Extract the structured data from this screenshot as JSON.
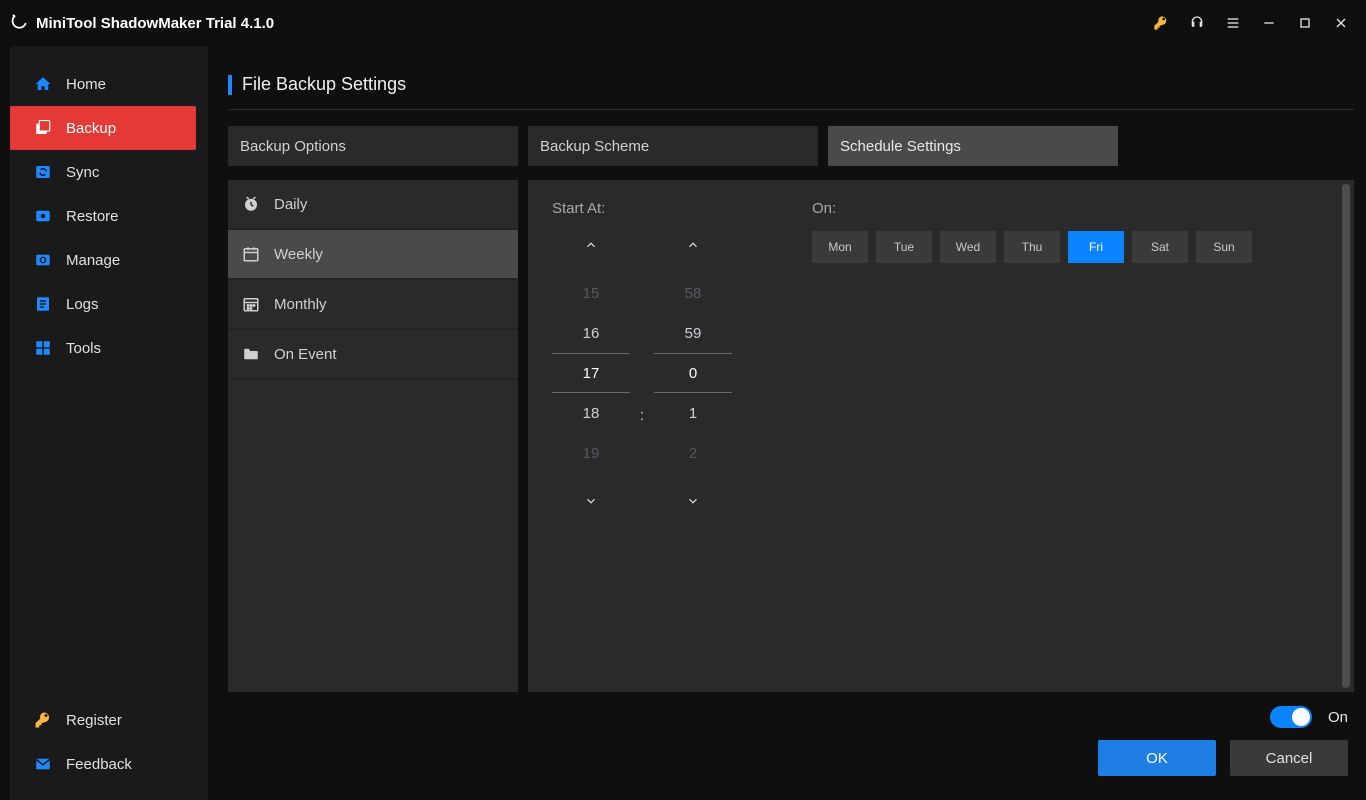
{
  "app": {
    "title": "MiniTool ShadowMaker Trial 4.1.0"
  },
  "sidebar": {
    "items": [
      {
        "label": "Home"
      },
      {
        "label": "Backup"
      },
      {
        "label": "Sync"
      },
      {
        "label": "Restore"
      },
      {
        "label": "Manage"
      },
      {
        "label": "Logs"
      },
      {
        "label": "Tools"
      }
    ],
    "bottom": [
      {
        "label": "Register"
      },
      {
        "label": "Feedback"
      }
    ]
  },
  "page": {
    "title": "File Backup Settings"
  },
  "tabs": [
    {
      "label": "Backup Options"
    },
    {
      "label": "Backup Scheme"
    },
    {
      "label": "Schedule Settings"
    }
  ],
  "schedule_modes": [
    {
      "label": "Daily"
    },
    {
      "label": "Weekly"
    },
    {
      "label": "Monthly"
    },
    {
      "label": "On Event"
    }
  ],
  "schedule": {
    "start_label": "Start At:",
    "on_label": "On:",
    "hour_wheel": [
      "15",
      "16",
      "17",
      "18",
      "19"
    ],
    "minute_wheel": [
      "58",
      "59",
      "0",
      "1",
      "2"
    ],
    "colon": ":",
    "days": [
      "Mon",
      "Tue",
      "Wed",
      "Thu",
      "Fri",
      "Sat",
      "Sun"
    ],
    "selected_day_index": 4,
    "selected_hour": "17",
    "selected_minute": "0"
  },
  "footer": {
    "toggle_label": "On",
    "ok": "OK",
    "cancel": "Cancel"
  }
}
